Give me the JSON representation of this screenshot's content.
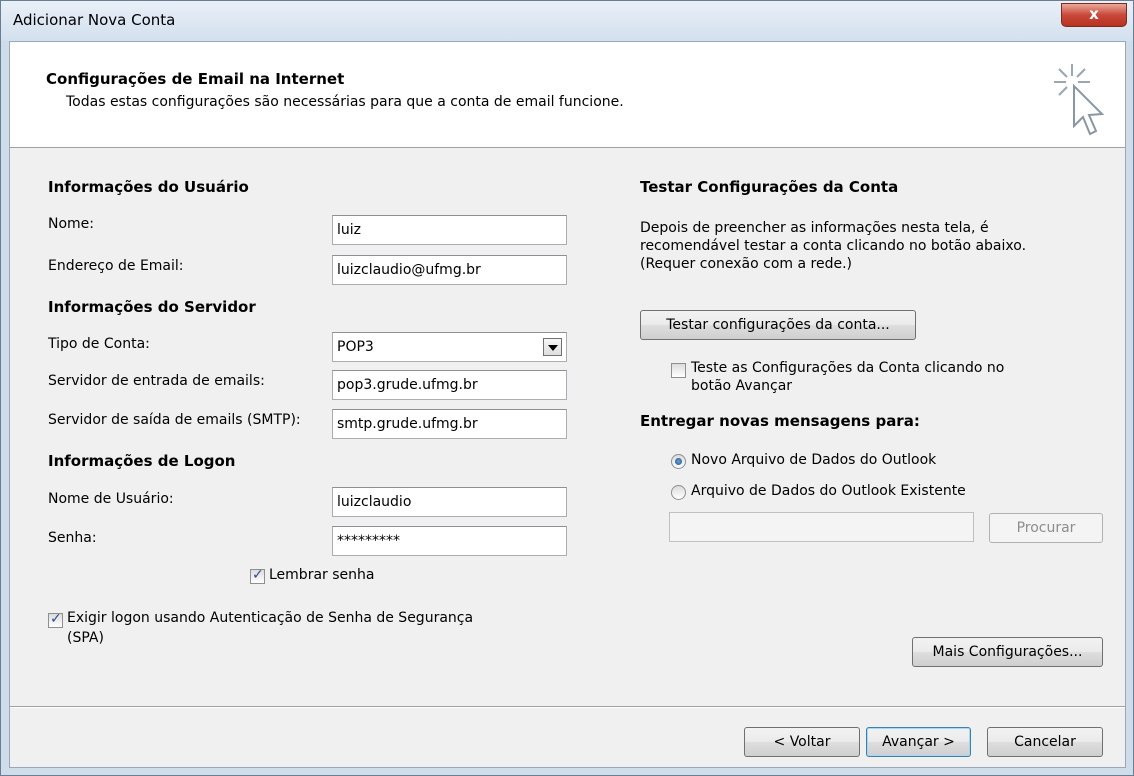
{
  "window": {
    "title": "Adicionar Nova Conta",
    "close_label": "x"
  },
  "header": {
    "title": "Configurações de Email na Internet",
    "subtitle": "Todas estas configurações são necessárias para que a conta de email funcione."
  },
  "user_info": {
    "heading": "Informações do Usuário",
    "name_label": "Nome:",
    "name_value": "luiz",
    "email_label": "Endereço de Email:",
    "email_value": "luizclaudio@ufmg.br"
  },
  "server_info": {
    "heading": "Informações do Servidor",
    "account_type_label": "Tipo de Conta:",
    "account_type_value": "POP3",
    "incoming_label": "Servidor de entrada de emails:",
    "incoming_value": "pop3.grude.ufmg.br",
    "outgoing_label": "Servidor de saída de emails (SMTP):",
    "outgoing_value": "smtp.grude.ufmg.br"
  },
  "logon_info": {
    "heading": "Informações de Logon",
    "username_label": "Nome de Usuário:",
    "username_value": "luizclaudio",
    "password_label": "Senha:",
    "password_value": "*********",
    "remember_label": "Lembrar senha",
    "remember_checked": true,
    "spa_label_line1": "Exigir logon usando Autenticação de Senha de Segurança",
    "spa_label_line2": "(SPA)",
    "spa_checked": true
  },
  "test_settings": {
    "heading": "Testar Configurações da Conta",
    "desc_line1": "Depois de preencher as informações nesta tela, é",
    "desc_line2": "recomendável testar a conta clicando no botão abaixo.",
    "desc_line3": "(Requer conexão com a rede.)",
    "test_button": "Testar configurações da conta...",
    "auto_test_line1": "Teste as Configurações da Conta clicando no",
    "auto_test_line2": "botão Avançar",
    "auto_test_checked": false
  },
  "delivery": {
    "heading": "Entregar novas mensagens para:",
    "option_new": "Novo Arquivo de Dados do Outlook",
    "option_existing": "Arquivo de Dados do Outlook Existente",
    "selected": "new",
    "file_path": "",
    "browse_button": "Procurar"
  },
  "more_settings_button": "Mais Configurações...",
  "nav": {
    "back": "< Voltar",
    "next": "Avançar >",
    "cancel": "Cancelar"
  }
}
